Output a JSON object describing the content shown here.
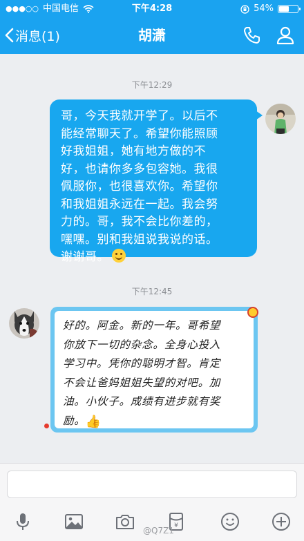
{
  "status_bar": {
    "carrier": "中国电信",
    "time": "下午4:28",
    "battery_text": "54%",
    "battery_level": 0.54
  },
  "nav": {
    "back_label": "消息(1)",
    "title": "胡潇"
  },
  "messages": [
    {
      "timestamp": "下午12:29",
      "direction": "outgoing",
      "lines": [
        "哥，今天我就开学了。以后不",
        "能经常聊天了。希望你能照顾",
        "好我姐姐，她有地方做的不",
        "好，也请你多多包容她。我很",
        "佩服你，也很喜欢你。希望你",
        "和我姐姐永远在一起。我会努",
        "力的。哥，我不会比你差的，",
        "嘿嘿。别和我姐说我说的话。",
        "谢谢哥。"
      ],
      "emoji": "smile-emoji"
    },
    {
      "timestamp": "下午12:45",
      "direction": "incoming",
      "lines": [
        "好的。阿金。新的一年。哥希望",
        "你放下一切的杂念。全身心投入",
        "学习中。凭你的聪明才智。肯定",
        "不会让爸妈姐姐失望的对吧。加",
        "油。小伙子。成绩有进步就有奖",
        "励。"
      ],
      "emoji": "👍"
    }
  ],
  "input": {
    "placeholder": ""
  },
  "toolbar": {
    "icons": [
      "microphone-icon",
      "image-icon",
      "camera-icon",
      "red-envelope-icon",
      "emoji-icon",
      "plus-icon"
    ]
  },
  "watermark": "@Q7Z1",
  "colors": {
    "nav_blue": "#1aa3f0",
    "outgoing_bubble": "#18a7ef",
    "incoming_frame": "#6cc6f1",
    "background": "#eceef1"
  }
}
